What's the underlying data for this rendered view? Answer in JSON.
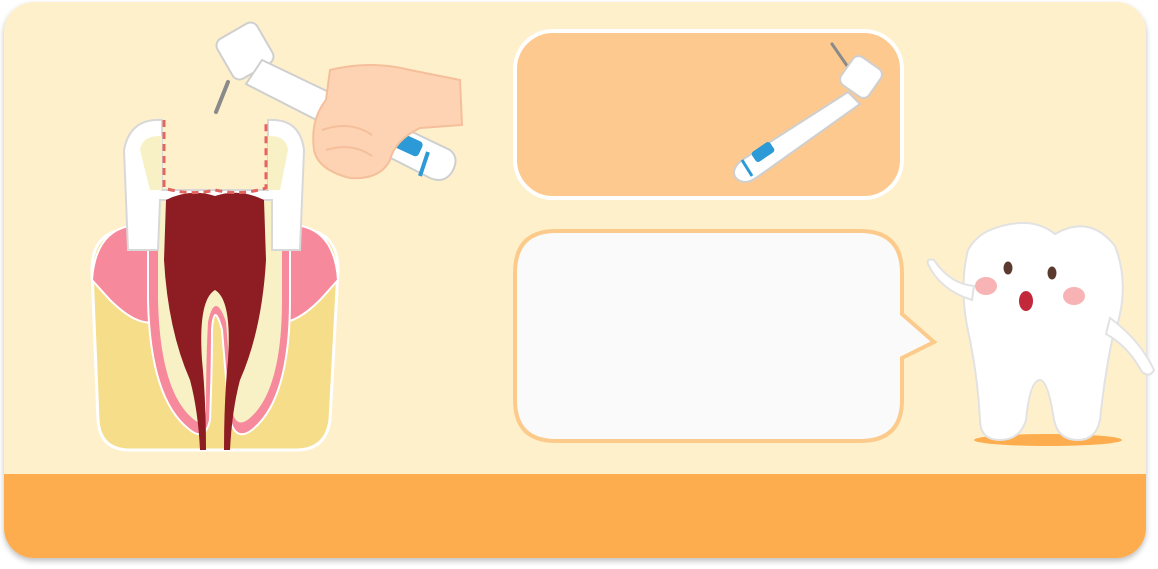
{
  "colors": {
    "background_panel": "#fff0cc",
    "bottom_band": "#fdad4e",
    "gum": "#f6899c",
    "bone": "#f5dd8a",
    "enamel": "#ffffff",
    "dentin": "#f7f1c5",
    "pulp": "#8d1c23",
    "info_box_top": "#fdc98f",
    "speech_bubble": "#fafafa",
    "bubble_border": "#fccb8c",
    "drill_stripe": "#2c9ad6",
    "cut_line": "#e4645e"
  },
  "icons": {
    "tooth_cross_section": "tooth-cross-section-icon",
    "hand_with_drill": "hand-drill-icon",
    "handpiece": "dental-handpiece-icon",
    "tooth_mascot": "tooth-mascot-icon"
  },
  "content": {
    "info_box_text": "",
    "speech_text": "",
    "footer_text": ""
  }
}
